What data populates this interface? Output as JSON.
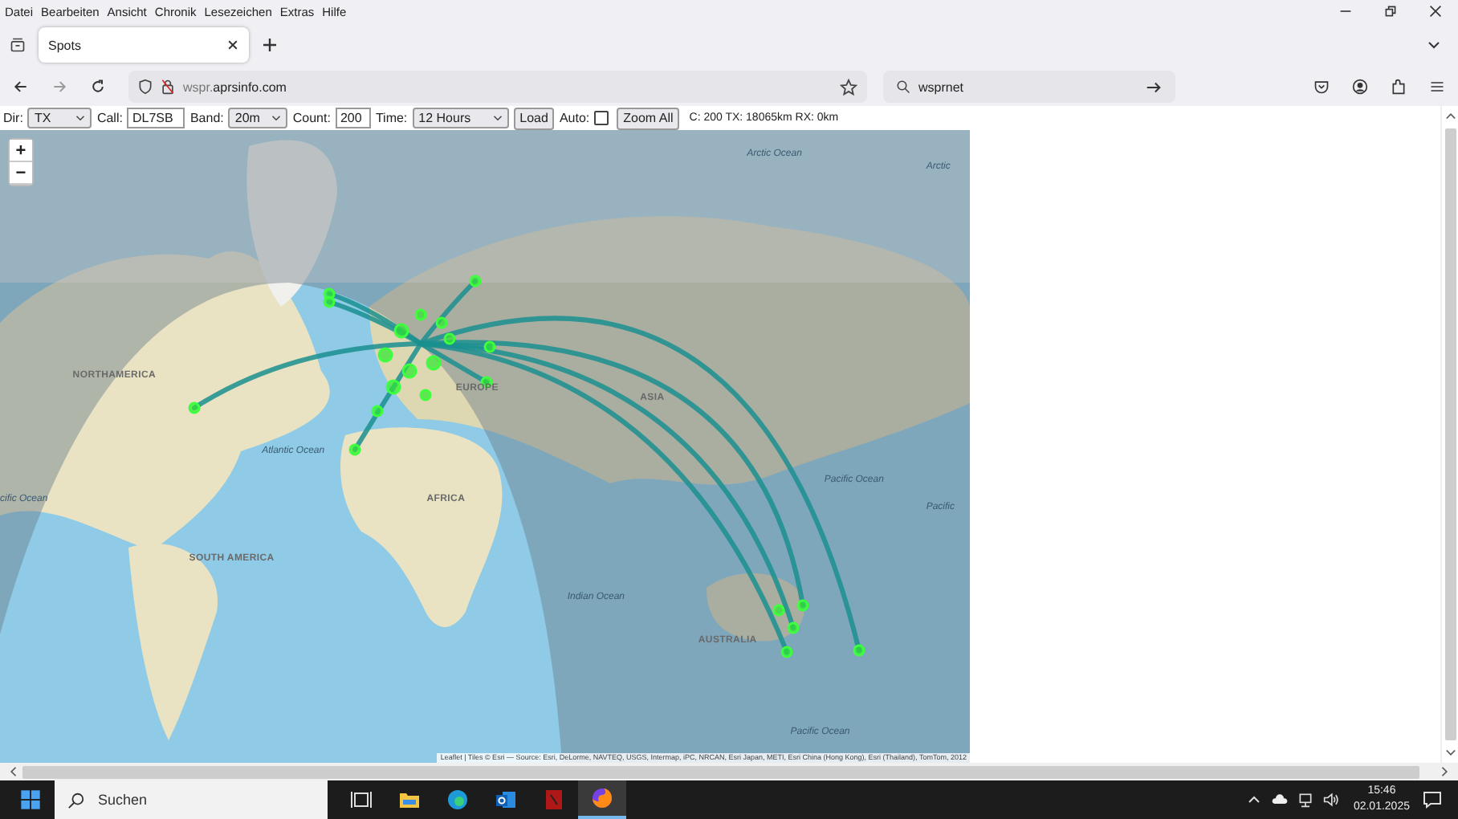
{
  "menu_bar": [
    "Datei",
    "Bearbeiten",
    "Ansicht",
    "Chronik",
    "Lesezeichen",
    "Extras",
    "Hilfe"
  ],
  "tabs": [
    {
      "label": "Spots",
      "selected": true
    }
  ],
  "address_bar": {
    "url": "wspr.**aprsinfo.com**"
  },
  "search_bar": {
    "value": "wsprnet"
  },
  "toolbar": [
    {
      "kind": "select",
      "label": "Dir:",
      "value": "TX"
    },
    {
      "kind": "input",
      "label": "Call:",
      "value": "DL7SB"
    },
    {
      "kind": "select",
      "label": "Band:",
      "value": "20m"
    },
    {
      "kind": "input",
      "label": "Count:",
      "value": "200"
    },
    {
      "kind": "select",
      "label": "Time:",
      "value": "12 Hours"
    },
    {
      "kind": "button",
      "label": "Load"
    },
    {
      "kind": "checkbox",
      "label": "Auto:",
      "checked": false
    },
    {
      "kind": "button",
      "label": "Zoom All"
    },
    {
      "kind": "text",
      "label": "C: 200 TX: 18065km RX: 0km"
    }
  ],
  "map": {
    "zoom_in": "+",
    "zoom_out": "−",
    "labels": [
      {
        "text": "Arctic Ocean",
        "kind": "ocean"
      },
      {
        "text": "Arctic",
        "kind": "ocean"
      },
      {
        "text": "NORTHAMERICA",
        "kind": "continent"
      },
      {
        "text": "ASIA",
        "kind": "continent"
      },
      {
        "text": "EUROPE",
        "kind": "continent"
      },
      {
        "text": "Atlantic Ocean",
        "kind": "ocean"
      },
      {
        "text": "cific Ocean",
        "kind": "ocean"
      },
      {
        "text": "Pacific Ocean",
        "kind": "ocean"
      },
      {
        "text": "Pacific",
        "kind": "ocean"
      },
      {
        "text": "AFRICA",
        "kind": "continent"
      },
      {
        "text": "SOUTH AMERICA",
        "kind": "continent"
      },
      {
        "text": "Indian Ocean",
        "kind": "ocean"
      },
      {
        "text": "AUSTRALIA",
        "kind": "continent"
      },
      {
        "text": "Pacific Ocean",
        "kind": "ocean"
      }
    ],
    "attribution": "Leaflet | Tiles © Esri — Source: Esri, DeLorme, NAVTEQ, USGS, Intermap, iPC, NRCAN, Esri Japan, METI, Esri China (Hong Kong), Esri (Thailand), TomTom, 2012"
  },
  "taskbar": {
    "search_placeholder": "Suchen",
    "time": "15:46",
    "date": "02.01.2025"
  }
}
